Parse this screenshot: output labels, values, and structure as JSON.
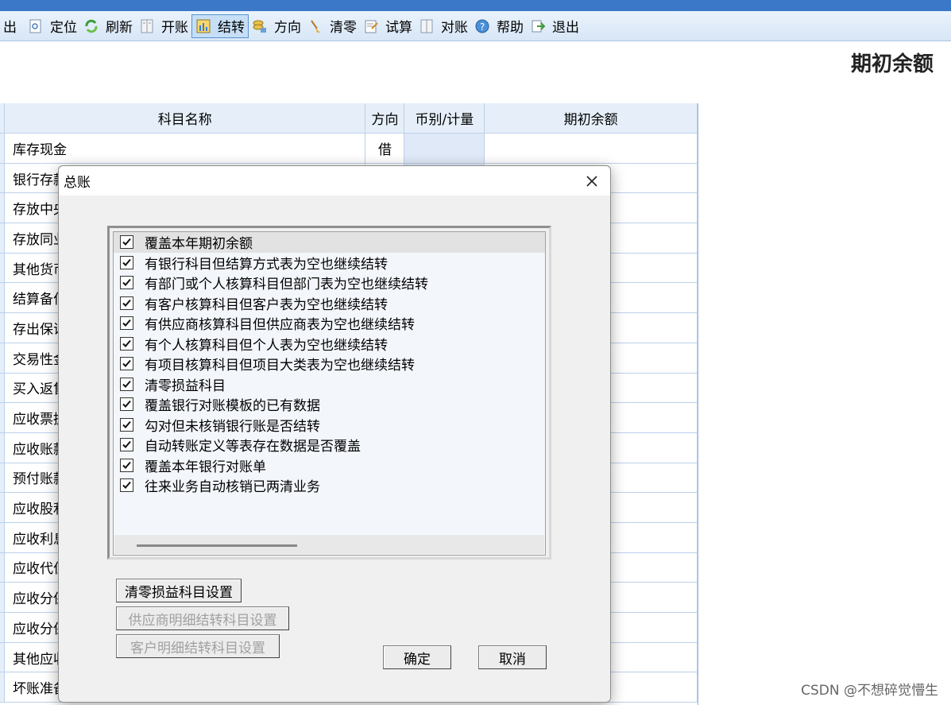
{
  "toolbar": {
    "items": [
      {
        "label": "出",
        "icon": "exit-partial-icon",
        "active": false
      },
      {
        "label": "定位",
        "icon": "locate-icon",
        "active": false
      },
      {
        "label": "刷新",
        "icon": "refresh-icon",
        "active": false
      },
      {
        "label": "开账",
        "icon": "open-ledger-icon",
        "active": false
      },
      {
        "label": "结转",
        "icon": "carry-forward-icon",
        "active": true
      },
      {
        "label": "方向",
        "icon": "direction-icon",
        "active": false
      },
      {
        "label": "清零",
        "icon": "broom-icon",
        "active": false
      },
      {
        "label": "试算",
        "icon": "trial-balance-icon",
        "active": false
      },
      {
        "label": "对账",
        "icon": "reconcile-icon",
        "active": false
      },
      {
        "label": "帮助",
        "icon": "help-icon",
        "active": false
      },
      {
        "label": "退出",
        "icon": "exit-icon",
        "active": false
      }
    ]
  },
  "page": {
    "title": "期初余额"
  },
  "grid": {
    "headers": [
      "科目名称",
      "方向",
      "币别/计量",
      "期初余额"
    ],
    "rows": [
      {
        "name": "库存现金",
        "dir": "借"
      },
      {
        "name": "银行存款",
        "dir": ""
      },
      {
        "name": "存放中央",
        "dir": ""
      },
      {
        "name": "存放同业",
        "dir": ""
      },
      {
        "name": "其他货币",
        "dir": ""
      },
      {
        "name": "结算备付",
        "dir": ""
      },
      {
        "name": "存出保证",
        "dir": ""
      },
      {
        "name": "交易性金",
        "dir": ""
      },
      {
        "name": "买入返售",
        "dir": ""
      },
      {
        "name": "应收票据",
        "dir": ""
      },
      {
        "name": "应收账款",
        "dir": ""
      },
      {
        "name": "预付账款",
        "dir": ""
      },
      {
        "name": "应收股利",
        "dir": ""
      },
      {
        "name": "应收利息",
        "dir": ""
      },
      {
        "name": "应收代位",
        "dir": ""
      },
      {
        "name": "应收分保",
        "dir": ""
      },
      {
        "name": "应收分保",
        "dir": ""
      },
      {
        "name": "其他应收",
        "dir": ""
      },
      {
        "name": "坏账准备",
        "dir": ""
      }
    ]
  },
  "dialog": {
    "title": "总账",
    "options": [
      {
        "label": "覆盖本年期初余额",
        "checked": true
      },
      {
        "label": "有银行科目但结算方式表为空也继续结转",
        "checked": true
      },
      {
        "label": "有部门或个人核算科目但部门表为空也继续结转",
        "checked": true
      },
      {
        "label": "有客户核算科目但客户表为空也继续结转",
        "checked": true
      },
      {
        "label": "有供应商核算科目但供应商表为空也继续结转",
        "checked": true
      },
      {
        "label": "有个人核算科目但个人表为空也继续结转",
        "checked": true
      },
      {
        "label": "有项目核算科目但项目大类表为空也继续结转",
        "checked": true
      },
      {
        "label": "清零损益科目",
        "checked": true
      },
      {
        "label": "覆盖银行对账模板的已有数据",
        "checked": true
      },
      {
        "label": "勾对但未核销银行账是否结转",
        "checked": true
      },
      {
        "label": "自动转账定义等表存在数据是否覆盖",
        "checked": true
      },
      {
        "label": "覆盖本年银行对账单",
        "checked": true
      },
      {
        "label": "往来业务自动核销已两清业务",
        "checked": true
      }
    ],
    "buttons": {
      "clear_pl_setup": "清零损益科目设置",
      "supplier_detail_setup": "供应商明细结转科目设置",
      "customer_detail_setup": "客户明细结转科目设置",
      "ok": "确定",
      "cancel": "取消"
    }
  },
  "watermark": "CSDN @不想碎觉懵生",
  "colors": {
    "accent": "#3c78c8",
    "grid_header": "#e6eff9",
    "dialog_bg": "#f0f0f0"
  }
}
